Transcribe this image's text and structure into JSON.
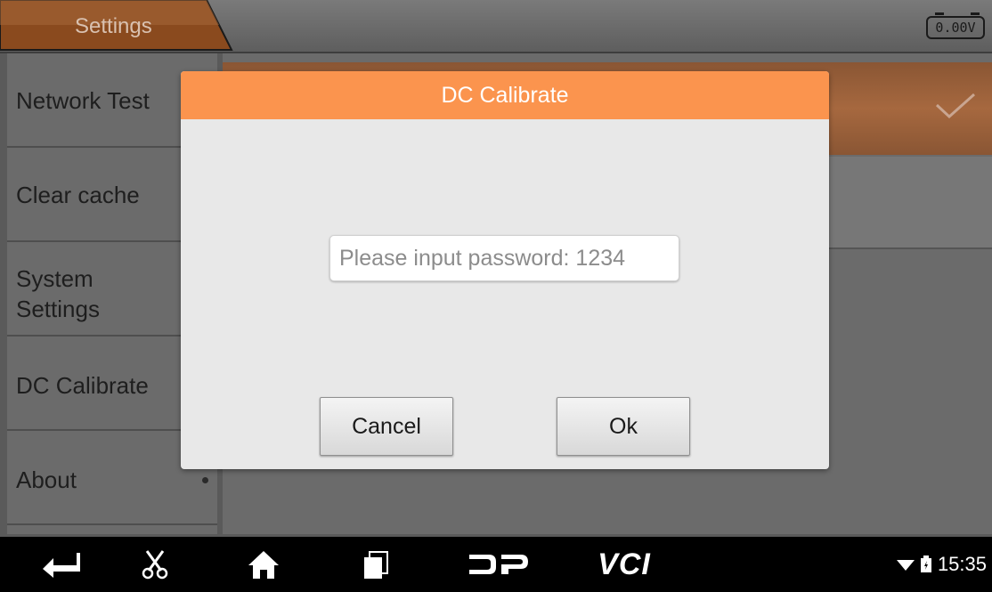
{
  "topbar": {
    "tab_label": "Settings",
    "voltage": "0.00V"
  },
  "sidebar": {
    "items": [
      {
        "label": "Network Test"
      },
      {
        "label": "Clear cache"
      },
      {
        "label": "System\nSettings"
      },
      {
        "label": "DC Calibrate"
      },
      {
        "label": "About"
      }
    ]
  },
  "dialog": {
    "title": "DC Calibrate",
    "password_placeholder": "Please input password: 1234",
    "password_value": "",
    "cancel_label": "Cancel",
    "ok_label": "Ok"
  },
  "navbar": {
    "icons": [
      "back-icon",
      "scissors-icon",
      "home-icon",
      "recent-apps-icon",
      "dp-logo-icon",
      "vci-icon"
    ],
    "vci_label": "VCI",
    "time": "15:35"
  },
  "colors": {
    "accent": "#fb944e",
    "selected_row": "#a6683f",
    "dialog_bg": "#e8e8e8"
  }
}
